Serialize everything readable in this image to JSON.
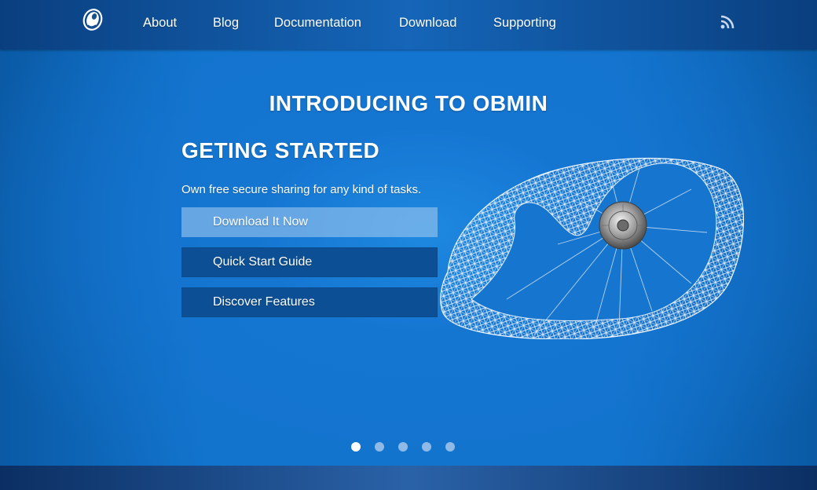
{
  "brand": {
    "logo_icon": "obmin-logo-icon"
  },
  "nav": {
    "items": [
      {
        "label": "About"
      },
      {
        "label": "Blog"
      },
      {
        "label": "Documentation"
      },
      {
        "label": "Download"
      },
      {
        "label": "Supporting"
      }
    ],
    "rss_icon": "rss-icon"
  },
  "hero": {
    "title": "INTRODUCING TO OBMIN",
    "slide": {
      "heading": "GETING STARTED",
      "text": "Own free secure sharing for any kind of tasks.",
      "buttons": [
        {
          "label": "Download It Now"
        },
        {
          "label": "Quick Start Guide"
        },
        {
          "label": "Discover Features"
        }
      ],
      "illustration": "wireframe-wheel-illustration"
    },
    "carousel": {
      "count": 5,
      "active_index": 0
    }
  },
  "colors": {
    "nav_bg": "#0a3f7f",
    "hero_bg": "#1273cc",
    "button_primary": "#8fbbe8",
    "button_secondary": "#0c4f94"
  }
}
